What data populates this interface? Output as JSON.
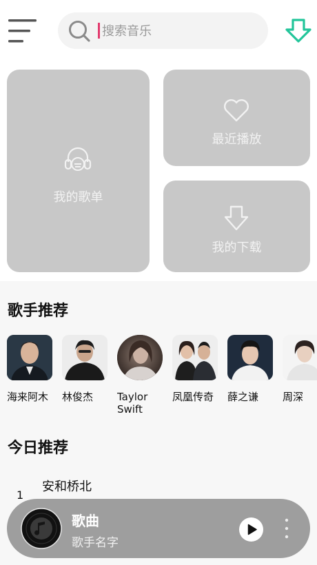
{
  "header": {
    "search_placeholder": "搜索音乐"
  },
  "cards": {
    "my_playlist": "我的歌单",
    "recent": "最近播放",
    "downloads": "我的下载"
  },
  "singers_section": {
    "title": "歌手推荐",
    "items": [
      {
        "name": "海来阿木"
      },
      {
        "name": "林俊杰"
      },
      {
        "name": "Taylor Swift"
      },
      {
        "name": "凤凰传奇"
      },
      {
        "name": "薛之谦"
      },
      {
        "name": "周深"
      }
    ]
  },
  "today_section": {
    "title": "今日推荐",
    "songs": [
      {
        "rank": "1",
        "title": "安和桥北"
      }
    ]
  },
  "player": {
    "title": "歌曲",
    "artist": "歌手名字"
  },
  "colors": {
    "accent": "#22c59a",
    "card": "#c8c8c8",
    "player": "#9e9e9e"
  }
}
